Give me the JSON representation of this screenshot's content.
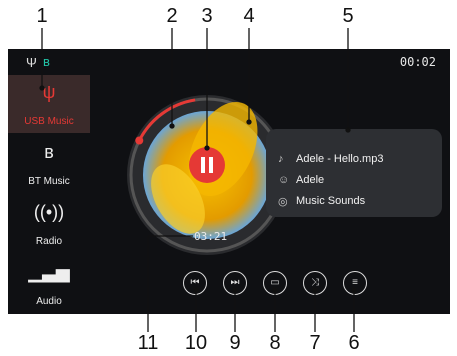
{
  "callouts": [
    "1",
    "2",
    "3",
    "4",
    "5",
    "6",
    "7",
    "8",
    "9",
    "10",
    "11"
  ],
  "status": {
    "clock": "00:02"
  },
  "sidebar": {
    "items": [
      {
        "label": "USB Music",
        "icon": "usb-icon"
      },
      {
        "label": "BT Music",
        "icon": "bluetooth-icon"
      },
      {
        "label": "Radio",
        "icon": "radio-antenna-icon"
      },
      {
        "label": "Audio",
        "icon": "equalizer-icon"
      }
    ]
  },
  "player": {
    "elapsed": "03:21",
    "progress": 0.15,
    "track": "Adele - Hello.mp3",
    "artist": "Adele",
    "album": "Music Sounds"
  },
  "colors": {
    "accent": "#e53935",
    "bluetooth": "#22c3a6"
  }
}
